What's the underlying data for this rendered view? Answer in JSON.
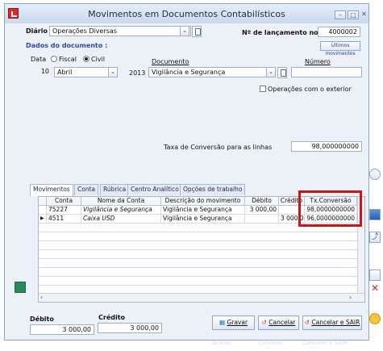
{
  "window": {
    "title": "Movimentos em Documentos Contabilísticos"
  },
  "header": {
    "diario_label": "Diário",
    "diario_value": "Operações Diversas",
    "lancamento_label": "Nº de lançamento no diário",
    "lancamento_value": "4000002",
    "ultimos_btn": "Últimos movimentos"
  },
  "dados": {
    "title": "Dados do documento :",
    "data_label": "Data",
    "fiscal_label": "Fiscal",
    "civil_label": "Civil",
    "documento_label": "Documento",
    "numero_label": "Número",
    "day": "10",
    "month": "Abril",
    "year": "2013",
    "documento_value": "Vigilância e Segurança",
    "operacoes_label": "Operações com o exterior",
    "taxa_label": "Taxa de Conversão para as linhas",
    "taxa_value": "98,000000000"
  },
  "tabs": [
    "Movimentos",
    "Conta",
    "Rúbrica",
    "Centro Analítico",
    "Opções de trabalho"
  ],
  "grid": {
    "columns": [
      "Conta",
      "Nome da Conta",
      "Descrição do movimento",
      "Débito",
      "Crédito",
      "Tx.Conversão"
    ],
    "rows": [
      {
        "conta": "75227",
        "nome": "Vigilância e Segurança",
        "descricao": "Vigilância e Segurança",
        "debito": "3 000,00",
        "credito": "",
        "tx": "98,0000000000"
      },
      {
        "conta": "4511",
        "nome": "Caixa USD",
        "descricao": "Vigilância e Segurança",
        "debito": "",
        "credito": "3 000,00",
        "tx": "96,0000000000"
      }
    ]
  },
  "totals": {
    "debito_label": "Débito",
    "debito_value": "3 000,00",
    "credito_label": "Crédito",
    "credito_value": "3 000,00"
  },
  "actions": {
    "gravar": "Gravar",
    "cancelar": "Cancelar",
    "cancelar_sair": "Cancelar e SAIR"
  },
  "colors": {
    "highlight": "#c8161b",
    "accent": "#2f4aa6"
  }
}
